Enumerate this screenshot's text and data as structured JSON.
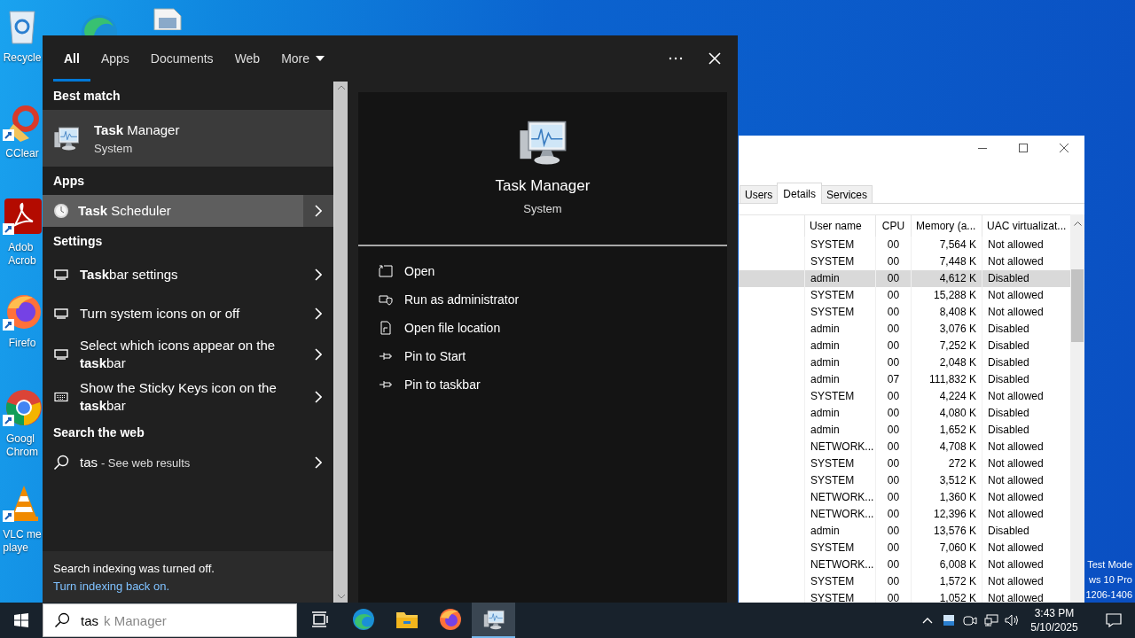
{
  "desktop": {
    "icons": [
      {
        "kind": "bin",
        "lines": [
          "Recycle"
        ]
      },
      {
        "kind": "broom",
        "lines": [
          "CClear"
        ]
      },
      {
        "kind": "document",
        "lines": [
          "Adob",
          "Acrob"
        ]
      },
      {
        "kind": "fox",
        "lines": [
          "Firefo"
        ]
      },
      {
        "kind": "browser",
        "lines": [
          "Googl",
          "Chrom"
        ]
      },
      {
        "kind": "cone",
        "lines": [
          "VLC me",
          "playe"
        ]
      }
    ],
    "notice": [
      "Test Mode",
      "ws 10 Pro",
      "1206-1406"
    ]
  },
  "search_flyout": {
    "tabs": [
      {
        "label": "All",
        "selected": true,
        "kind": "tab"
      },
      {
        "label": "Apps",
        "selected": false,
        "kind": "tab"
      },
      {
        "label": "Documents",
        "selected": false,
        "kind": "tab"
      },
      {
        "label": "Web",
        "selected": false,
        "kind": "tab"
      },
      {
        "label": "More",
        "selected": false,
        "kind": "menu"
      }
    ],
    "sections": [
      {
        "title": "Best match",
        "items": [
          {
            "kind": "best-match",
            "title": "**Task** Manager",
            "subtitle": "System",
            "selected": true,
            "hovered": false
          }
        ]
      },
      {
        "title": "Apps",
        "items": [
          {
            "kind": "app",
            "title": "**Task** Scheduler",
            "selected": false,
            "hovered": true
          }
        ]
      },
      {
        "title": "Settings",
        "items": [
          {
            "kind": "setting",
            "title": "**Task**bar settings",
            "selected": false,
            "hovered": false
          },
          {
            "kind": "setting",
            "title": "Turn system icons on or off",
            "selected": false,
            "hovered": false
          },
          {
            "kind": "setting",
            "title": "Select which icons appear on the **task**bar",
            "selected": false,
            "hovered": false
          },
          {
            "kind": "keyboard-setting",
            "title": "Show the Sticky Keys icon on the **task**bar",
            "selected": false,
            "hovered": false
          }
        ]
      },
      {
        "title": "Search the web",
        "items": [
          {
            "kind": "web",
            "title": "tas",
            "suffix": "- See web results",
            "selected": false,
            "hovered": false
          }
        ]
      }
    ],
    "preview": {
      "title": "Task Manager",
      "subtitle": "System",
      "actions": [
        {
          "kind": "open",
          "label": "Open"
        },
        {
          "kind": "run-as-admin",
          "label": "Run as administrator"
        },
        {
          "kind": "file-location",
          "label": "Open file location"
        },
        {
          "kind": "pin",
          "label": "Pin to Start"
        },
        {
          "kind": "pin",
          "label": "Pin to taskbar"
        }
      ]
    },
    "footer": {
      "message": "Search indexing was turned off.",
      "link": "Turn indexing back on."
    }
  },
  "task_manager": {
    "tabs": [
      {
        "label": "Users",
        "selected": false
      },
      {
        "label": "Details",
        "selected": true
      },
      {
        "label": "Services",
        "selected": false
      }
    ],
    "columns": [
      "User name",
      "CPU",
      "Memory (a...",
      "UAC virtualizat..."
    ],
    "rows": [
      {
        "cells": [
          "SYSTEM",
          "00",
          "7,564 K",
          "Not allowed"
        ],
        "selected": false
      },
      {
        "cells": [
          "SYSTEM",
          "00",
          "7,448 K",
          "Not allowed"
        ],
        "selected": false
      },
      {
        "cells": [
          "admin",
          "00",
          "4,612 K",
          "Disabled"
        ],
        "selected": true
      },
      {
        "cells": [
          "SYSTEM",
          "00",
          "15,288 K",
          "Not allowed"
        ],
        "selected": false
      },
      {
        "cells": [
          "SYSTEM",
          "00",
          "8,408 K",
          "Not allowed"
        ],
        "selected": false
      },
      {
        "cells": [
          "admin",
          "00",
          "3,076 K",
          "Disabled"
        ],
        "selected": false
      },
      {
        "cells": [
          "admin",
          "00",
          "7,252 K",
          "Disabled"
        ],
        "selected": false
      },
      {
        "cells": [
          "admin",
          "00",
          "2,048 K",
          "Disabled"
        ],
        "selected": false
      },
      {
        "cells": [
          "admin",
          "07",
          "111,832 K",
          "Disabled"
        ],
        "selected": false
      },
      {
        "cells": [
          "SYSTEM",
          "00",
          "4,224 K",
          "Not allowed"
        ],
        "selected": false
      },
      {
        "cells": [
          "admin",
          "00",
          "4,080 K",
          "Disabled"
        ],
        "selected": false
      },
      {
        "cells": [
          "admin",
          "00",
          "1,652 K",
          "Disabled"
        ],
        "selected": false
      },
      {
        "cells": [
          "NETWORK...",
          "00",
          "4,708 K",
          "Not allowed"
        ],
        "selected": false
      },
      {
        "cells": [
          "SYSTEM",
          "00",
          "272 K",
          "Not allowed"
        ],
        "selected": false
      },
      {
        "cells": [
          "SYSTEM",
          "00",
          "3,512 K",
          "Not allowed"
        ],
        "selected": false
      },
      {
        "cells": [
          "NETWORK...",
          "00",
          "1,360 K",
          "Not allowed"
        ],
        "selected": false
      },
      {
        "cells": [
          "NETWORK...",
          "00",
          "12,396 K",
          "Not allowed"
        ],
        "selected": false
      },
      {
        "cells": [
          "admin",
          "00",
          "13,576 K",
          "Disabled"
        ],
        "selected": false
      },
      {
        "cells": [
          "SYSTEM",
          "00",
          "7,060 K",
          "Not allowed"
        ],
        "selected": false
      },
      {
        "cells": [
          "NETWORK...",
          "00",
          "6,008 K",
          "Not allowed"
        ],
        "selected": false
      },
      {
        "cells": [
          "SYSTEM",
          "00",
          "1,572 K",
          "Not allowed"
        ],
        "selected": false
      },
      {
        "cells": [
          "SYSTEM",
          "00",
          "1,052 K",
          "Not allowed"
        ],
        "selected": false
      }
    ]
  },
  "taskbar": {
    "search": {
      "value": "tas",
      "suggestion": "k Manager"
    },
    "apps": [
      {
        "kind": "task-view",
        "active": false
      },
      {
        "kind": "wave-browser",
        "active": false
      },
      {
        "kind": "folder",
        "active": false
      },
      {
        "kind": "fox-browser",
        "active": false
      },
      {
        "kind": "monitor",
        "active": true
      }
    ],
    "time": "3:43 PM",
    "date": "5/10/2025"
  }
}
